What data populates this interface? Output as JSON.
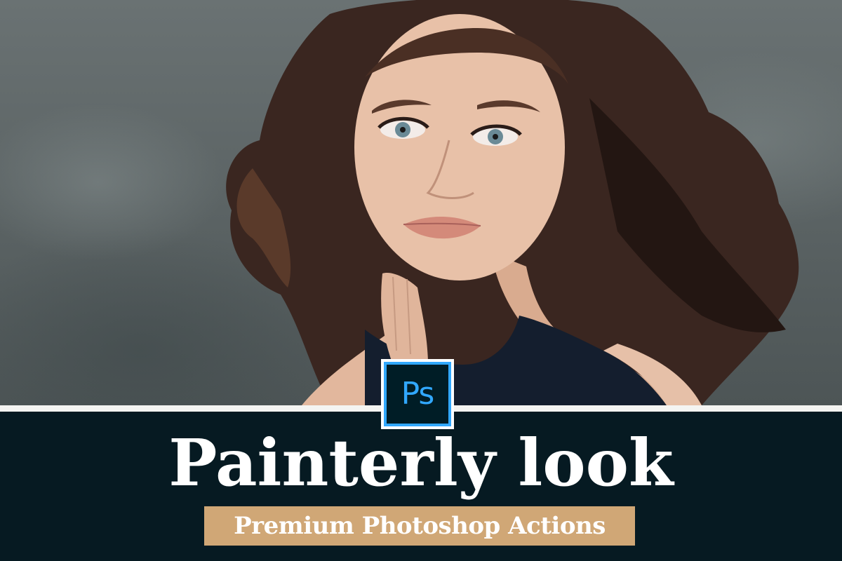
{
  "badge": {
    "label": "Ps",
    "accent_color": "#31a8ff",
    "background_color": "#001d26"
  },
  "title": "Painterly look",
  "subtitle": "Premium Photoshop Actions",
  "colors": {
    "band": "#061a22",
    "subtitle_box": "#d0a776",
    "text": "#ffffff"
  }
}
